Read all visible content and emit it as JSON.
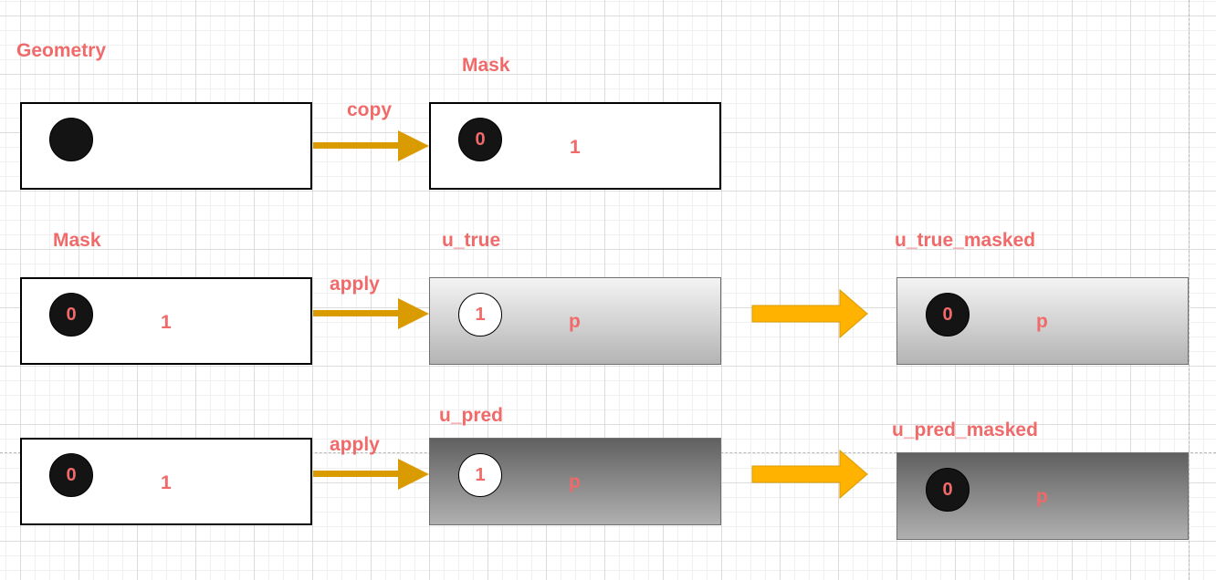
{
  "row1": {
    "geometry_title": "Geometry",
    "mask_title": "Mask",
    "copy_label": "copy",
    "mask_zero": "0",
    "mask_one": "1"
  },
  "row2": {
    "mask_title": "Mask",
    "apply_label": "apply",
    "u_true_title": "u_true",
    "u_true_masked_title": "u_true_masked",
    "mask_zero": "0",
    "mask_one": "1",
    "u_true_one": "1",
    "u_true_p": "p",
    "masked_zero": "0",
    "masked_p": "p"
  },
  "row3": {
    "apply_label": "apply",
    "u_pred_title": "u_pred",
    "u_pred_masked_title": "u_pred_masked",
    "mask_zero": "0",
    "mask_one": "1",
    "u_pred_one": "1",
    "u_pred_p": "p",
    "masked_zero": "0",
    "masked_p": "p"
  },
  "colors": {
    "label": "#f06a6a",
    "apply_arrow": "#d99b00",
    "result_arrow": "#ffb300",
    "circle_fill": "#141414"
  }
}
